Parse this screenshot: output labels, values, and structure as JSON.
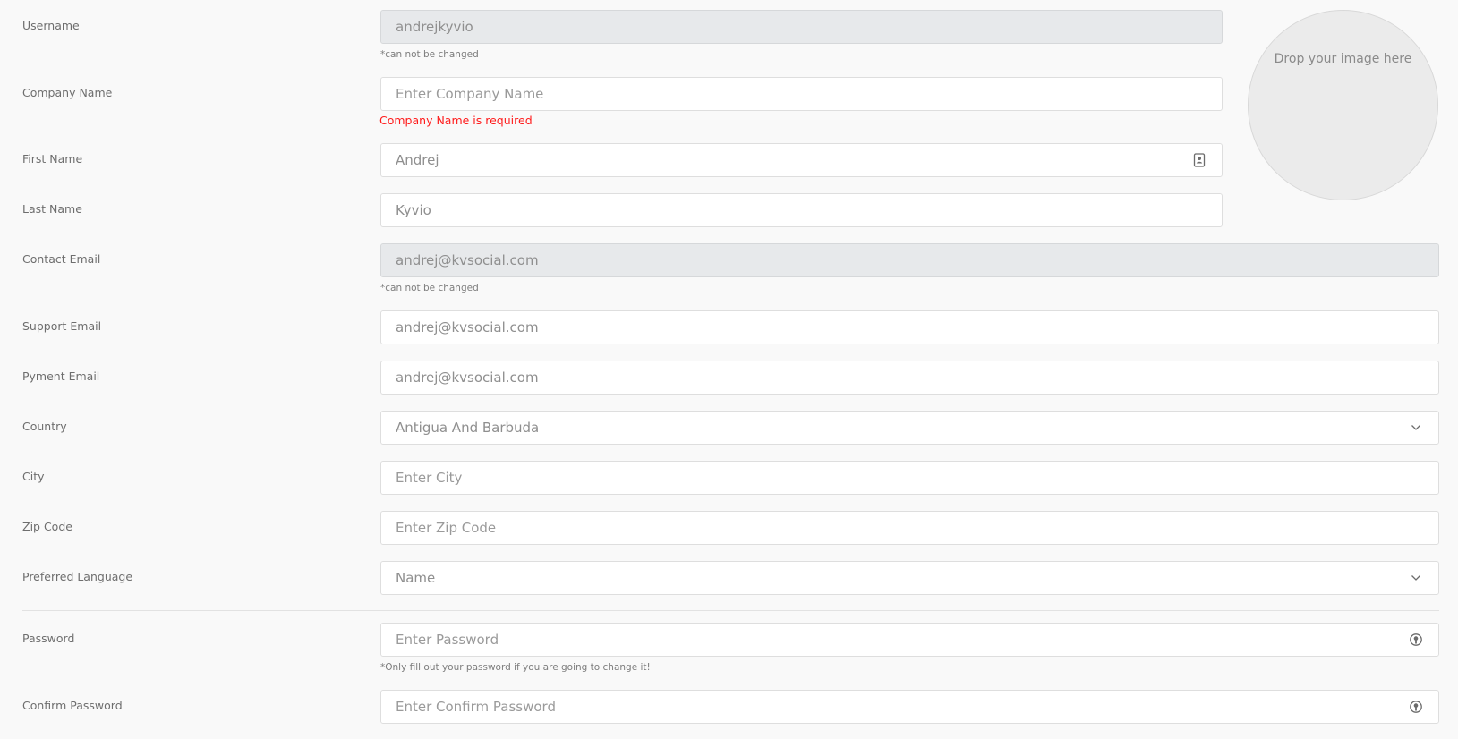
{
  "profile_form": {
    "username": {
      "label": "Username",
      "value": "andrejkyvio",
      "note": "*can not be changed"
    },
    "company_name": {
      "label": "Company Name",
      "placeholder": "Enter Company Name",
      "error": "Company Name is required"
    },
    "first_name": {
      "label": "First Name",
      "value": "Andrej"
    },
    "last_name": {
      "label": "Last Name",
      "value": "Kyvio"
    },
    "contact_email": {
      "label": "Contact Email",
      "value": "andrej@kvsocial.com",
      "note": "*can not be changed"
    },
    "support_email": {
      "label": "Support Email",
      "value": "andrej@kvsocial.com"
    },
    "payment_email": {
      "label": "Pyment Email",
      "value": "andrej@kvsocial.com"
    },
    "country": {
      "label": "Country",
      "selected": "Antigua And Barbuda"
    },
    "city": {
      "label": "City",
      "placeholder": "Enter City"
    },
    "zip_code": {
      "label": "Zip Code",
      "placeholder": "Enter Zip Code"
    },
    "preferred_language": {
      "label": "Preferred Language",
      "selected": "Name"
    },
    "password": {
      "label": "Password",
      "placeholder": "Enter Password",
      "note": "*Only fill out your password if you are going to change it!"
    },
    "confirm_password": {
      "label": "Confirm Password",
      "placeholder": "Enter Confirm Password"
    }
  },
  "avatar_upload": {
    "text": "Drop your image here"
  },
  "icons": {
    "first_name": "contact-card-icon",
    "country": "chevron-down-icon",
    "preferred_language": "chevron-down-icon",
    "password": "password-visibility-icon",
    "confirm_password": "password-visibility-icon"
  },
  "colors": {
    "background": "#f9f9f9",
    "field_border": "#dedede",
    "disabled_field": "#e7e9eb",
    "error": "#ff1a1a",
    "label": "#6e6e6e"
  }
}
